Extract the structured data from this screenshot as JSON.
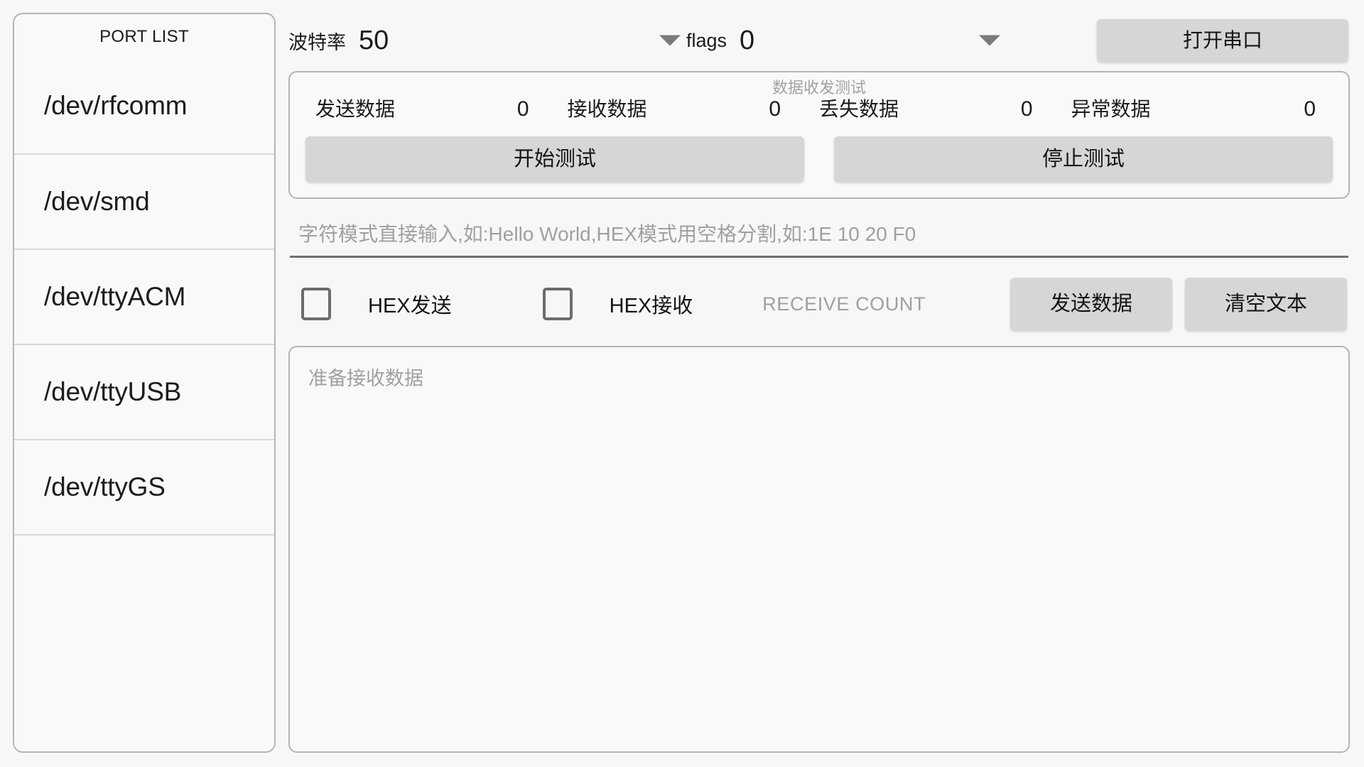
{
  "sidebar": {
    "title": "PORT LIST",
    "ports": [
      "/dev/rfcomm",
      "/dev/smd",
      "/dev/ttyACM",
      "/dev/ttyUSB",
      "/dev/ttyGS"
    ]
  },
  "topbar": {
    "baud_label": "波特率",
    "baud_value": "50",
    "flags_label": "flags",
    "flags_value": "0",
    "open_button": "打开串口",
    "caret_icon": "chevron-down-icon"
  },
  "test_panel": {
    "title": "数据收发测试",
    "counters": [
      {
        "label": "发送数据",
        "value": "0"
      },
      {
        "label": "接收数据",
        "value": "0"
      },
      {
        "label": "丢失数据",
        "value": "0"
      },
      {
        "label": "异常数据",
        "value": "0"
      }
    ],
    "start_button": "开始测试",
    "stop_button": "停止测试"
  },
  "send": {
    "input_value": "",
    "input_placeholder": "字符模式直接输入,如:Hello World,HEX模式用空格分割,如:1E 10 20 F0"
  },
  "options": {
    "hex_send_label": "HEX发送",
    "hex_send_checked": false,
    "hex_receive_label": "HEX接收",
    "hex_receive_checked": false,
    "receive_count_label": "RECEIVE COUNT",
    "send_button": "发送数据",
    "clear_button": "清空文本"
  },
  "receive": {
    "text": "准备接收数据"
  },
  "colors": {
    "page_background": "#f7f7f7",
    "panel_background": "#f9f9f9",
    "panel_border": "#b5b5b5",
    "button_background": "#d6d6d6",
    "primary_text": "#1b1b1b",
    "muted_text": "#a0a0a0",
    "divider": "#d8d8d8",
    "input_underline": "#6f6f6f",
    "checkbox_border": "#6c6c6c",
    "caret_fill": "#7a7a7a"
  }
}
